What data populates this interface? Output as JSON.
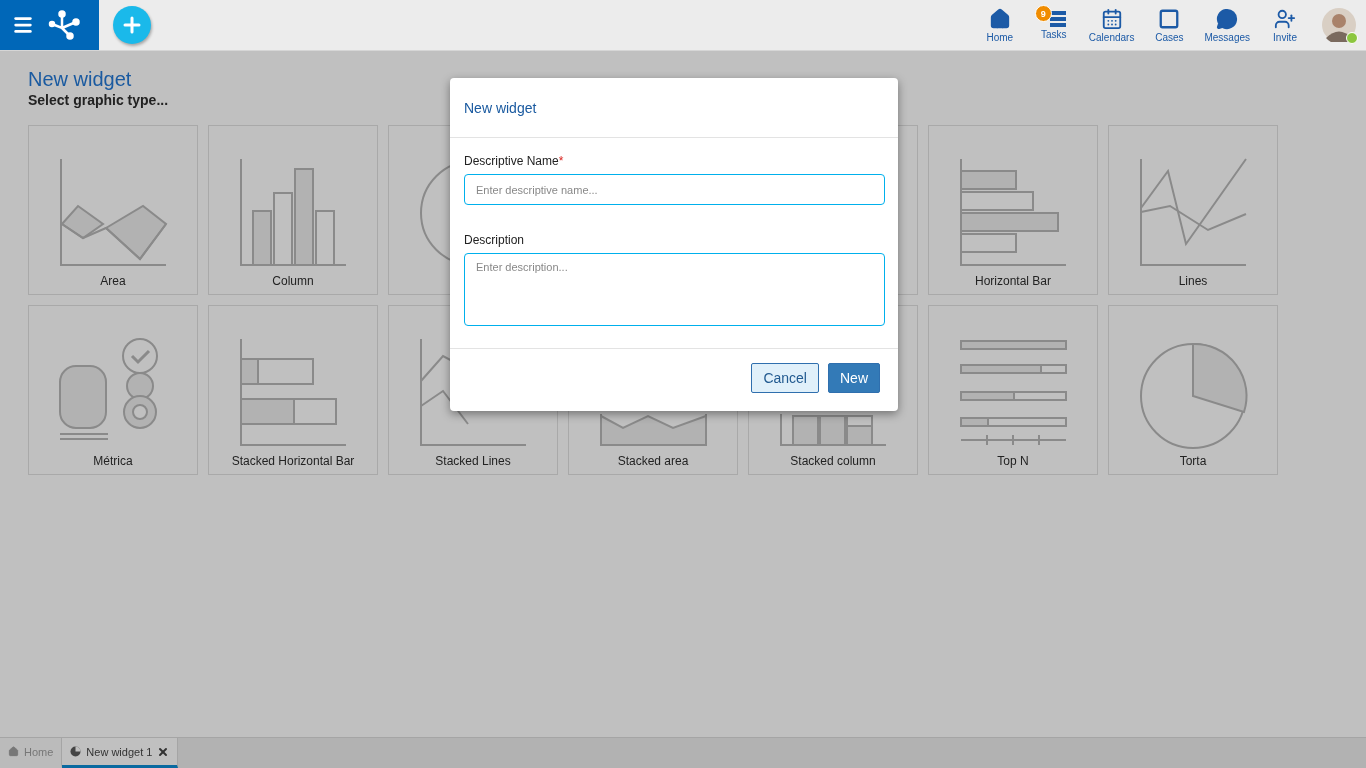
{
  "topbar": {
    "nav": [
      {
        "kind": "home",
        "label": "Home"
      },
      {
        "kind": "tasks",
        "label": "Tasks",
        "badge": "9"
      },
      {
        "kind": "calendars",
        "label": "Calendars"
      },
      {
        "kind": "cases",
        "label": "Cases"
      },
      {
        "kind": "messages",
        "label": "Messages"
      },
      {
        "kind": "invite",
        "label": "Invite"
      }
    ],
    "avatar": {
      "online": true
    }
  },
  "page": {
    "title": "New widget",
    "subtitle": "Select graphic type...",
    "tiles": [
      {
        "kind": "area",
        "label": "Area"
      },
      {
        "kind": "column",
        "label": "Column"
      },
      {
        "kind": "circle"
      },
      {
        "kind": "blank"
      },
      {
        "kind": "hbar",
        "label": "Horizontal Bar"
      },
      {
        "kind": "lines",
        "label": "Lines"
      },
      {
        "kind": "metric",
        "label": "Métrica"
      },
      {
        "kind": "stacked-hbar",
        "label": "Stacked Horizontal Bar"
      },
      {
        "kind": "stacked-lines",
        "label": "Stacked Lines"
      },
      {
        "kind": "stacked-area",
        "label": "Stacked area"
      },
      {
        "kind": "stacked-column",
        "label": "Stacked column"
      },
      {
        "kind": "topn",
        "label": "Top N"
      },
      {
        "kind": "pie",
        "label": "Torta"
      }
    ]
  },
  "dialog": {
    "title": "New widget",
    "fields": [
      {
        "label": "Descriptive Name",
        "required_mark": "*",
        "placeholder": "Enter descriptive name...",
        "multiline": false
      },
      {
        "label": "Description",
        "placeholder": "Enter description...",
        "multiline": true
      }
    ],
    "buttons": [
      {
        "kind": "secondary",
        "label": "Cancel"
      },
      {
        "kind": "primary",
        "label": "New"
      }
    ]
  },
  "tabs": [
    {
      "kind": "home",
      "label": "Home",
      "selected": false,
      "closable": false
    },
    {
      "kind": "widget",
      "label": "New widget 1",
      "selected": true,
      "closable": true
    }
  ]
}
